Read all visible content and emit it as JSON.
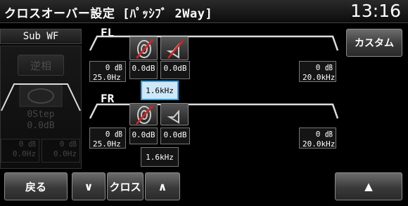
{
  "header": {
    "title": "クロスオーバー設定 [ﾊﾟｯｼﾌﾞ 2Way]",
    "clock": "13:16"
  },
  "left": {
    "title": "Sub WF",
    "invert": "逆相",
    "step": {
      "line1": "0Step",
      "line2": "0.0dB"
    },
    "cells": [
      {
        "l1": "0 ㏈",
        "l2": "0.0Hz"
      },
      {
        "l1": "0 ㏈",
        "l2": "0.0Hz"
      }
    ]
  },
  "fl": {
    "label": "FL",
    "hp": {
      "slope": "0 ㏈",
      "freq": "25.0Hz"
    },
    "lp": {
      "slope": "0 ㏈",
      "freq": "20.0kHz"
    },
    "gain_low": "0.0dB",
    "gain_high": "0.0dB",
    "cross_freq": "1.6kHz"
  },
  "fr": {
    "label": "FR",
    "hp": {
      "slope": "0 ㏈",
      "freq": "25.0Hz"
    },
    "lp": {
      "slope": "0 ㏈",
      "freq": "20.0kHz"
    },
    "gain_low": "0.0dB",
    "gain_high": "0.0dB",
    "cross_freq": "1.6kHz"
  },
  "right": {
    "custom": "カスタム"
  },
  "bottom": {
    "back": "戻る",
    "down": "∨",
    "cross": "クロス",
    "up": "∧",
    "eject": "▲"
  }
}
